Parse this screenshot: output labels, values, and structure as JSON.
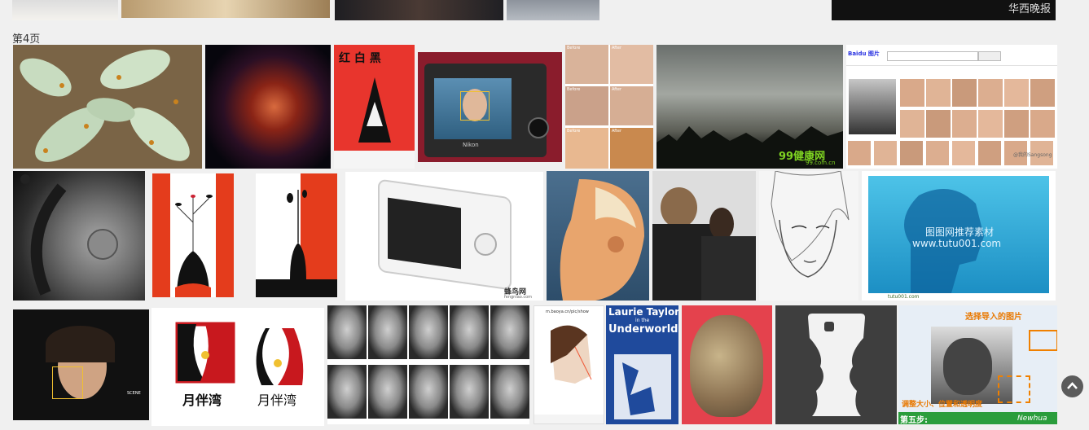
{
  "page": {
    "label": "第4页"
  },
  "images": [
    {
      "name": "leaves-moths"
    },
    {
      "name": "nebula"
    },
    {
      "name": "book-cover",
      "text": "红 白 黑"
    },
    {
      "name": "camera-face-detect",
      "brand": "Nikon"
    },
    {
      "name": "nose-before-after",
      "labels": [
        "Before",
        "After",
        "Before",
        "After",
        "Before",
        "After"
      ]
    },
    {
      "name": "cloudy-sky",
      "watermark": "99健康网",
      "watermark_sub": "99.com.cn"
    },
    {
      "name": "baidu-face-search",
      "logo": "Baidu 图片",
      "credit": "@我的Sangsong"
    },
    {
      "name": "moon-crater"
    },
    {
      "name": "vase-faces-red"
    },
    {
      "name": "vase-faces-white"
    },
    {
      "name": "white-camera",
      "watermark": "蜂鸟网",
      "watermark_sub": "fengniao.com"
    },
    {
      "name": "angel-face-illusion"
    },
    {
      "name": "two-women"
    },
    {
      "name": "girl-sketch"
    },
    {
      "name": "blue-head",
      "watermark": "图图网推荐素材",
      "watermark_sub": "www.tutu001.com",
      "credit": "tutu001.com"
    },
    {
      "name": "face-tracking-woman",
      "label": "SCENE"
    },
    {
      "name": "logo-faces",
      "text_left": "月伴湾",
      "text_right": "月伴湾"
    },
    {
      "name": "faces-grid-glasses"
    },
    {
      "name": "phone-head-diagram",
      "url": "m.baoya.cn/pic/show"
    },
    {
      "name": "book-underworld",
      "title_line1": "Laurie Taylor",
      "title_line2": "in the",
      "title_line3": "Underworld"
    },
    {
      "name": "rock-face"
    },
    {
      "name": "phone-case-silhouette"
    },
    {
      "name": "software-tutorial",
      "step1": "选择导入的图片",
      "step2": "调整大小、位置和透明度",
      "step5": "第五步:",
      "brand": "Newhua"
    }
  ],
  "controls": {
    "scroll_top_icon": "chevron-up-icon"
  }
}
